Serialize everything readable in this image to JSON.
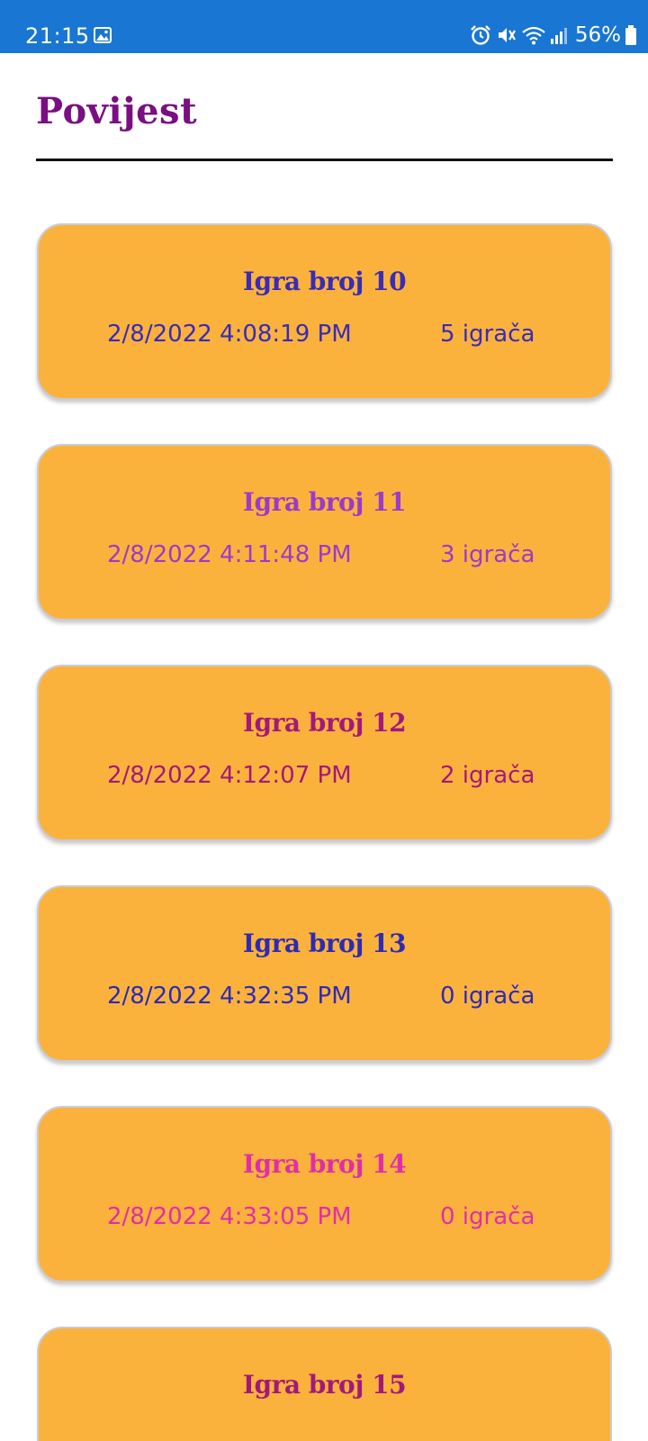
{
  "status_bar": {
    "time": "21:15",
    "battery": "56%",
    "icons": [
      "gallery-icon",
      "alarm-icon",
      "mute-icon",
      "wifi-icon",
      "signal-icon",
      "battery-icon"
    ]
  },
  "header": {
    "title": "Povijest"
  },
  "games": [
    {
      "title": "Igra broj 10",
      "date": "2/8/2022 4:08:19 PM",
      "players": "5 igrača",
      "color": "#3a2bb8"
    },
    {
      "title": "Igra broj 11",
      "date": "2/8/2022 4:11:48 PM",
      "players": "3 igrača",
      "color": "#9b3bc9"
    },
    {
      "title": "Igra broj 12",
      "date": "2/8/2022 4:12:07 PM",
      "players": "2 igrača",
      "color": "#a3197a"
    },
    {
      "title": "Igra broj 13",
      "date": "2/8/2022 4:32:35 PM",
      "players": "0 igrača",
      "color": "#2f2ab5"
    },
    {
      "title": "Igra broj 14",
      "date": "2/8/2022 4:33:05 PM",
      "players": "0 igrača",
      "color": "#e02ea8"
    },
    {
      "title": "Igra broj 15",
      "color": "#a3197a"
    }
  ]
}
